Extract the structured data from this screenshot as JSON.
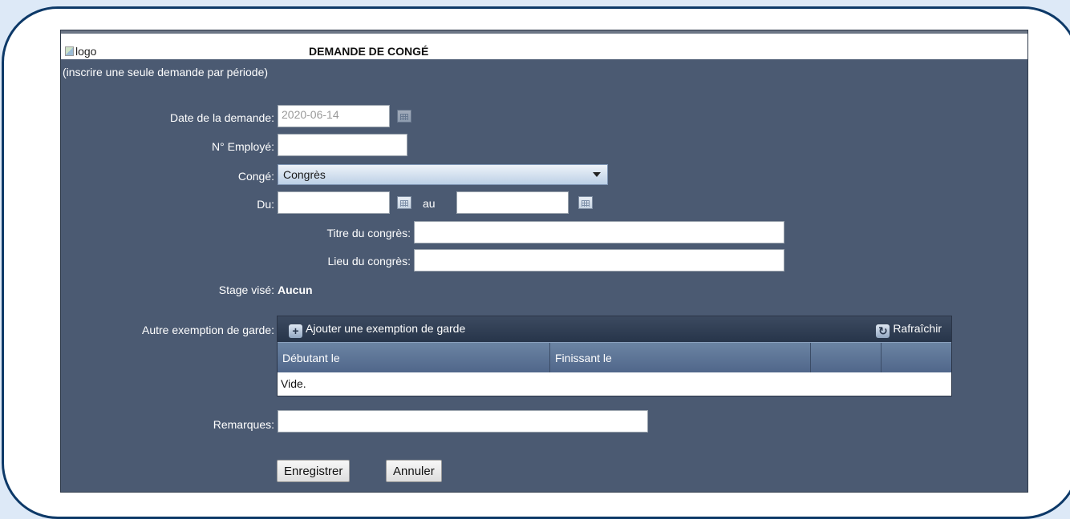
{
  "header": {
    "logo_alt": "logo",
    "title": "DEMANDE DE CONGÉ",
    "subtitle": "(inscrire une seule demande par période)"
  },
  "form": {
    "date_label": "Date de la demande:",
    "date_value": "2020-06-14",
    "employee_label": "N° Employé:",
    "employee_value": "",
    "conge_label": "Congé:",
    "conge_value": "Congrès",
    "du_label": "Du:",
    "du_value": "",
    "au_label": "au",
    "au_value": "",
    "titre_label": "Titre du congrès:",
    "titre_value": "",
    "lieu_label": "Lieu du congrès:",
    "lieu_value": "",
    "stage_label": "Stage visé:",
    "stage_value": "Aucun",
    "exemption_label": "Autre exemption de garde:",
    "remarques_label": "Remarques:",
    "remarques_value": ""
  },
  "grid": {
    "add_label": "Ajouter une exemption de garde",
    "refresh_label": "Rafraîchir",
    "columns": [
      "Débutant le",
      "Finissant le",
      "",
      ""
    ],
    "empty_text": "Vide."
  },
  "actions": {
    "save_label": "Enregistrer",
    "cancel_label": "Annuler"
  },
  "colors": {
    "panel_bg": "#4b5a72",
    "frame_border": "#0d3968",
    "page_bg": "#dde9f7"
  }
}
